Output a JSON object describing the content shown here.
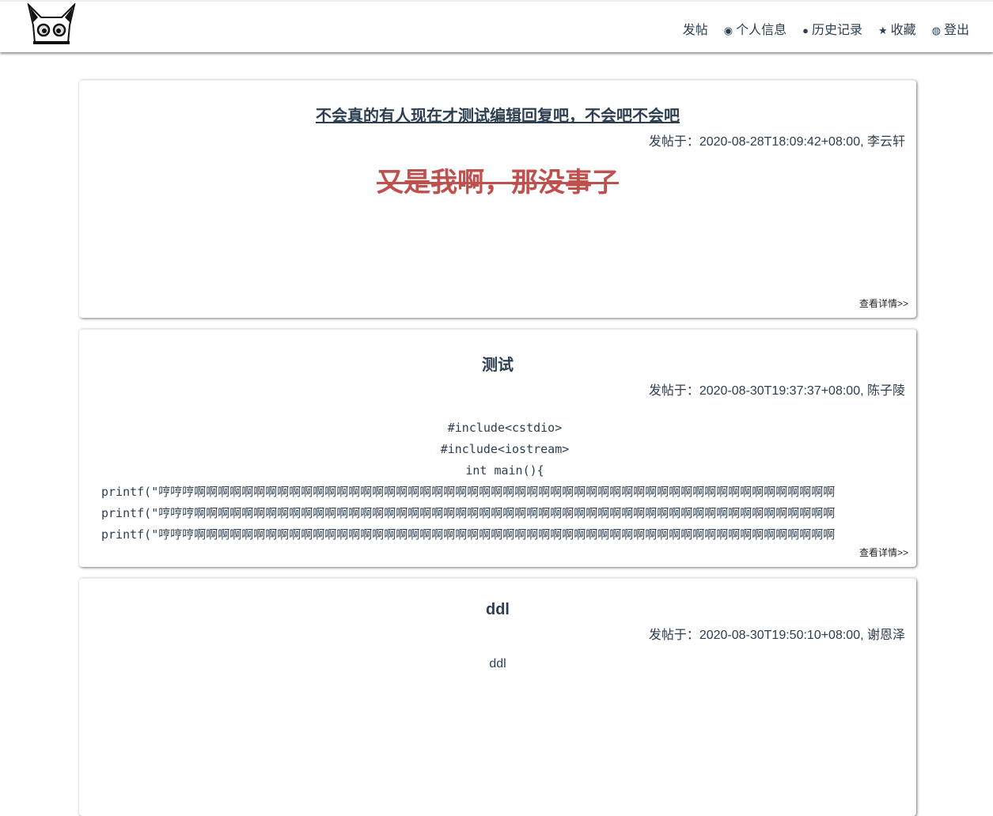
{
  "nav": {
    "items": [
      {
        "label": "发帖",
        "icon": ""
      },
      {
        "label": "个人信息",
        "icon": "user-circle-icon"
      },
      {
        "label": "历史记录",
        "icon": "clock-icon"
      },
      {
        "label": "收藏",
        "icon": "star-icon"
      },
      {
        "label": "登出",
        "icon": "user-outline-icon"
      }
    ]
  },
  "posts": [
    {
      "title": "不会真的有人现在才测试编辑回复吧，不会吧不会吧",
      "meta": "发帖于：2020-08-28T18:09:42+08:00, 李云轩",
      "body": "又是我啊，那没事了",
      "more": "查看详情>>"
    },
    {
      "title": "测试",
      "meta": "发帖于：2020-08-30T19:37:37+08:00, 陈子陵",
      "code": [
        "#include<cstdio>",
        "#include<iostream>",
        "int main(){",
        "printf(\"哼哼哼啊啊啊啊啊啊啊啊啊啊啊啊啊啊啊啊啊啊啊啊啊啊啊啊啊啊啊啊啊啊啊啊啊啊啊啊啊啊啊啊啊啊啊啊啊啊啊啊啊啊啊啊啊啊",
        "printf(\"哼哼哼啊啊啊啊啊啊啊啊啊啊啊啊啊啊啊啊啊啊啊啊啊啊啊啊啊啊啊啊啊啊啊啊啊啊啊啊啊啊啊啊啊啊啊啊啊啊啊啊啊啊啊啊啊啊",
        "printf(\"哼哼哼啊啊啊啊啊啊啊啊啊啊啊啊啊啊啊啊啊啊啊啊啊啊啊啊啊啊啊啊啊啊啊啊啊啊啊啊啊啊啊啊啊啊啊啊啊啊啊啊啊啊啊啊啊啊"
      ],
      "more": "查看详情>>"
    },
    {
      "title": "ddl",
      "meta": "发帖于：2020-08-30T19:50:10+08:00, 谢恩泽",
      "body": "ddl"
    }
  ],
  "colors": {
    "accent": "#c0504d",
    "text": "#2c3e50"
  }
}
